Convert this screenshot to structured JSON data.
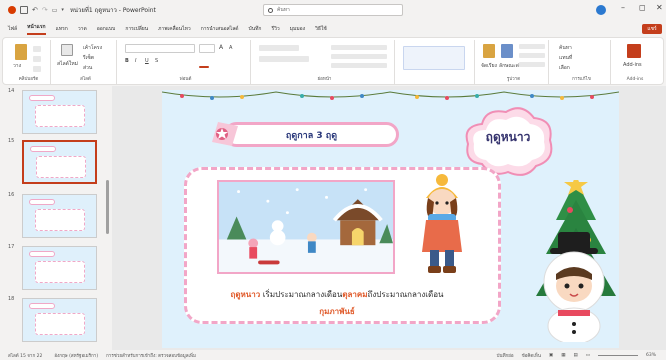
{
  "titlebar": {
    "doc_title": "หน่วยที่1 ฤดูหนาว - PowerPoint",
    "search_placeholder": "ค้นหา"
  },
  "tabs": [
    "ไฟล์",
    "หน้าแรก",
    "แทรก",
    "วาด",
    "ออกแบบ",
    "การเปลี่ยน",
    "ภาพเคลื่อนไหว",
    "การนำเสนอสไลด์",
    "บันทึก",
    "รีวิว",
    "มุมมอง",
    "วิธีใช้"
  ],
  "share_label": "แชร์",
  "ribbon": {
    "groups": [
      "คลิปบอร์ด",
      "สไลด์",
      "ฟอนต์",
      "ย่อหน้า",
      "",
      "รูปวาด",
      "การแก้ไข",
      "Add-ins"
    ],
    "clipboard_paste": "วาง",
    "slides_new": "สไลด์ใหม่",
    "slides_layout": "เค้าโครง",
    "slides_reset": "รีเซ็ต",
    "slides_section": "ส่วน",
    "font_size_up": "A",
    "font_size_down": "A",
    "arrange": "จัดเรียง",
    "quick_styles": "ลักษณะด่วน",
    "find": "ค้นหา",
    "replace": "แทนที่",
    "select": "เลือก",
    "addin": "Add-ins"
  },
  "thumbs": [
    {
      "num": "14"
    },
    {
      "num": "15"
    },
    {
      "num": "16"
    },
    {
      "num": "17"
    },
    {
      "num": "18"
    }
  ],
  "slide": {
    "header": "ฤดูกาล 3 ฤดู",
    "season_title": "ฤดูหนาว",
    "text_hl1": "ฤดูหนาว",
    "text_part1": " เริ่มประมาณกลางเดือน",
    "text_hl2": "ตุลาคม",
    "text_part2": "ถึงประมาณกลางเดือน",
    "text_hl3": "กุมภาพันธ์"
  },
  "status": {
    "slide_info": "สไลด์ 15 จาก 22",
    "language": "อังกฤษ (สหรัฐอเมริกา)",
    "accessibility": "การช่วยสำหรับการเข้าถึง: ตรวจสอบข้อมูลเพิ่ม",
    "notes": "บันทึกย่อ",
    "comments": "ข้อคิดเห็น",
    "zoom": "63%"
  },
  "colors": {
    "accent": "#c43e1c",
    "pink": "#f2a6c7",
    "navy": "#29377a"
  }
}
